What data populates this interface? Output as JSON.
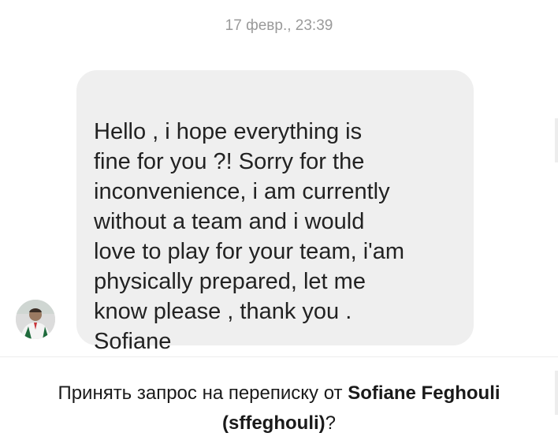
{
  "conversation": {
    "timestamp": "17 февр., 23:39",
    "message": {
      "text": "Hello , i hope everything is\nfine for you ?! Sorry for the\ninconvenience, i am currently\nwithout a team and i would\nlove to play for your team, i'am\nphysically prepared, let me\nknow please , thank you .\nSofiane",
      "sender_avatar_icon": "user-avatar-photo"
    }
  },
  "request_prompt": {
    "prefix": "Принять запрос на переписку от ",
    "name": "Sofiane Feghouli",
    "handle": "(sffeghouli)",
    "suffix": "?"
  },
  "colors": {
    "bubble_bg": "#efefef",
    "timestamp_text": "#9a9a9a",
    "message_text": "#222222"
  }
}
